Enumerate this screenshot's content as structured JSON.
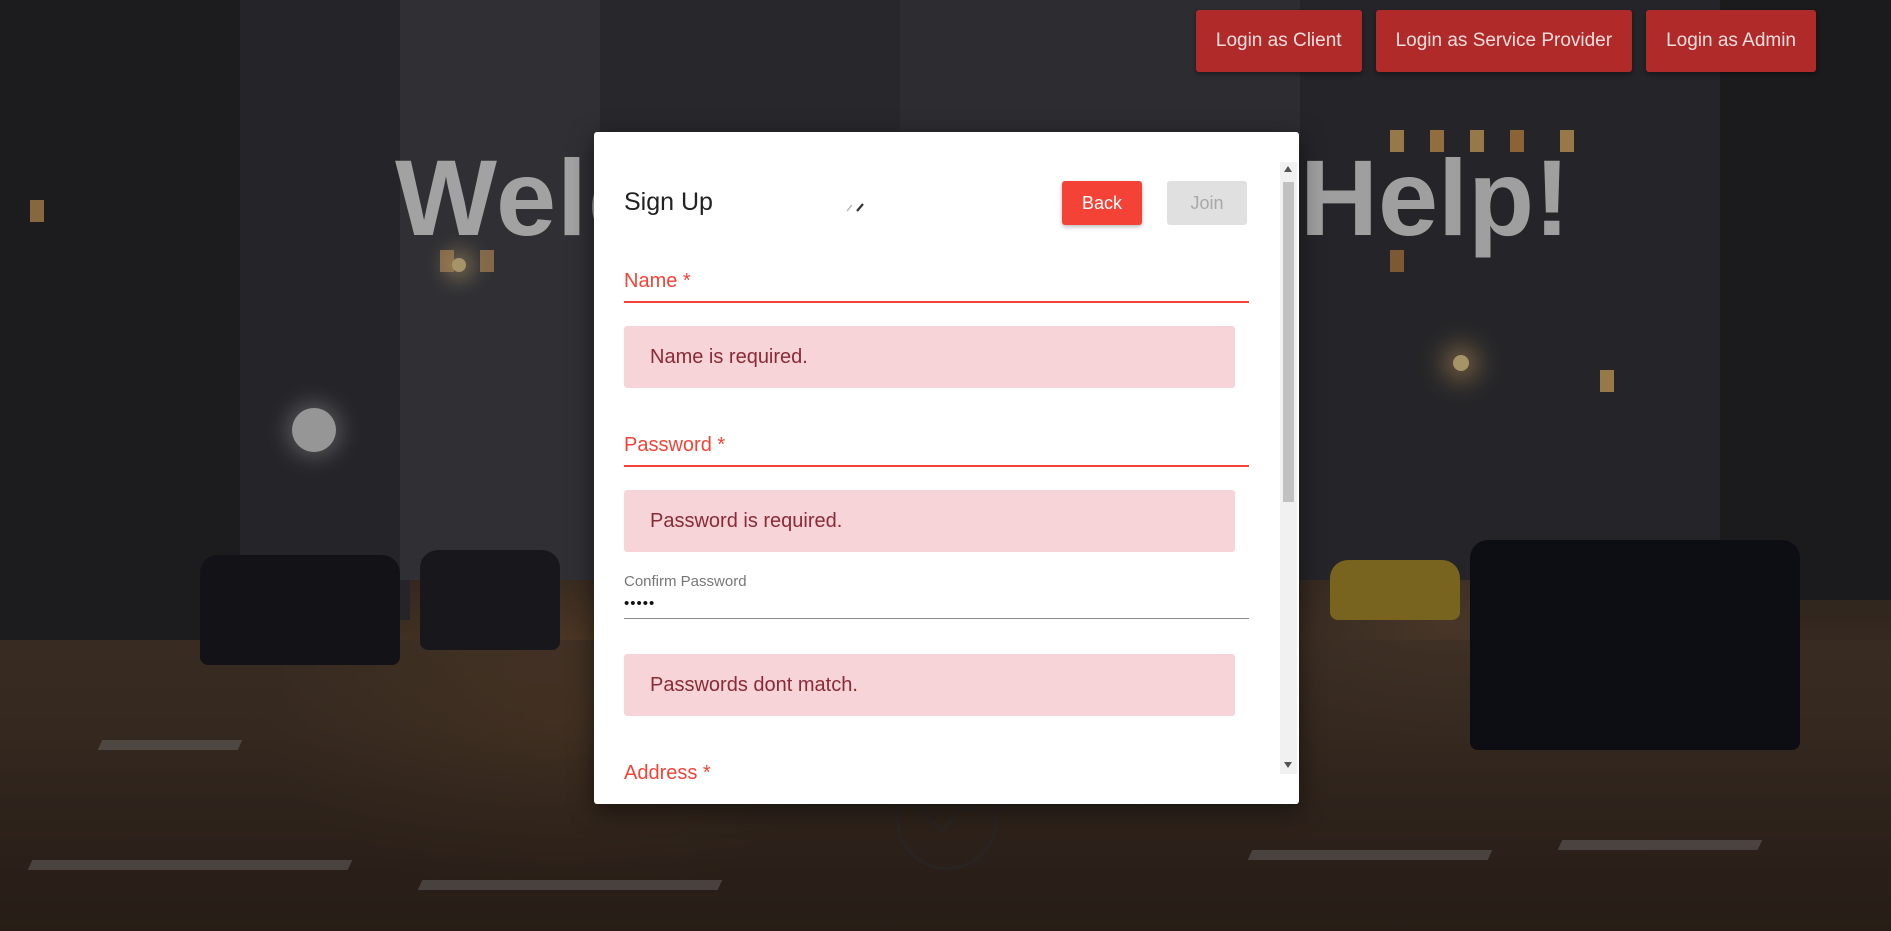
{
  "nav": {
    "client_label": "Login as Client",
    "provider_label": "Login as Service Provider",
    "admin_label": "Login as Admin"
  },
  "hero": {
    "welcome_left": "Welc",
    "welcome_right": "Help!"
  },
  "modal": {
    "title": "Sign Up",
    "back_label": "Back",
    "join_label": "Join",
    "fields": {
      "name": {
        "label": "Name *",
        "value": "",
        "error": "Name is required."
      },
      "password": {
        "label": "Password *",
        "value": "",
        "error": "Password is required."
      },
      "confirm_password": {
        "label": "Confirm Password",
        "value": "•••••",
        "error": "Passwords dont match."
      },
      "address": {
        "label": "Address *"
      }
    }
  },
  "colors": {
    "primary_red": "#f44336",
    "nav_red": "#b02a2a",
    "alert_bg": "#f7d4d8",
    "alert_text": "#8a2a35"
  },
  "icons": {
    "pencil": "pencil-icon",
    "scroll_down": "chevron-down-icon"
  }
}
